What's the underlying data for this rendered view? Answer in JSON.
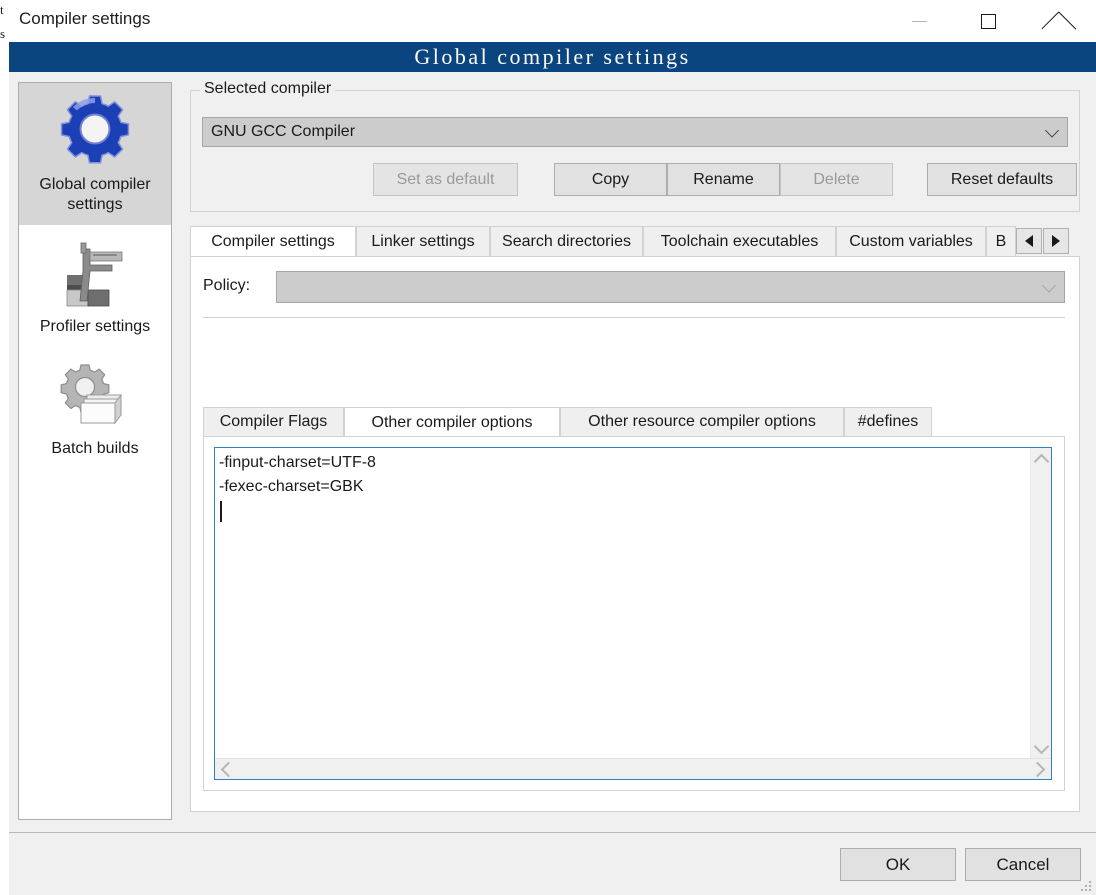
{
  "window": {
    "title": "Compiler settings",
    "header_banner": "Global compiler settings",
    "behind_text_1": "t",
    "behind_text_2": "s",
    "controls": {
      "minimize": "—",
      "maximize": "□",
      "close": "✕"
    }
  },
  "sidebar": {
    "items": [
      {
        "label": "Global compiler settings",
        "icon": "blue-gear-icon",
        "selected": true
      },
      {
        "label": "Profiler settings",
        "icon": "caliper-cubes-icon",
        "selected": false
      },
      {
        "label": "Batch builds",
        "icon": "gear-pages-icon",
        "selected": false
      }
    ]
  },
  "selected_compiler": {
    "legend": "Selected compiler",
    "value": "GNU GCC Compiler",
    "buttons": [
      {
        "label": "Set as default",
        "disabled": true
      },
      {
        "label": "Copy",
        "disabled": false
      },
      {
        "label": "Rename",
        "disabled": false
      },
      {
        "label": "Delete",
        "disabled": true
      },
      {
        "label": "Reset defaults",
        "disabled": false
      }
    ]
  },
  "tabs": {
    "items": [
      {
        "label": "Compiler settings",
        "active": true
      },
      {
        "label": "Linker settings",
        "active": false
      },
      {
        "label": "Search directories",
        "active": false
      },
      {
        "label": "Toolchain executables",
        "active": false
      },
      {
        "label": "Custom variables",
        "active": false
      },
      {
        "label": "B",
        "active": false
      }
    ],
    "scroll_left": "◀",
    "scroll_right": "▶"
  },
  "policy": {
    "label": "Policy:",
    "value": "",
    "disabled": true
  },
  "inner_tabs": {
    "items": [
      {
        "label": "Compiler Flags",
        "active": false
      },
      {
        "label": "Other compiler options",
        "active": true
      },
      {
        "label": "Other resource compiler options",
        "active": false
      },
      {
        "label": "#defines",
        "active": false
      }
    ]
  },
  "editor": {
    "content": "-finput-charset=UTF-8\n-fexec-charset=GBK",
    "lines": [
      "-finput-charset=UTF-8",
      "-fexec-charset=GBK"
    ]
  },
  "footer": {
    "ok_label": "OK",
    "cancel_label": "Cancel"
  },
  "colors": {
    "banner_blue": "#0b4580",
    "dialog_bg": "#f0f0f0",
    "focus_border": "#2f7fc4",
    "selected_item_bg": "#d6d6d6"
  }
}
